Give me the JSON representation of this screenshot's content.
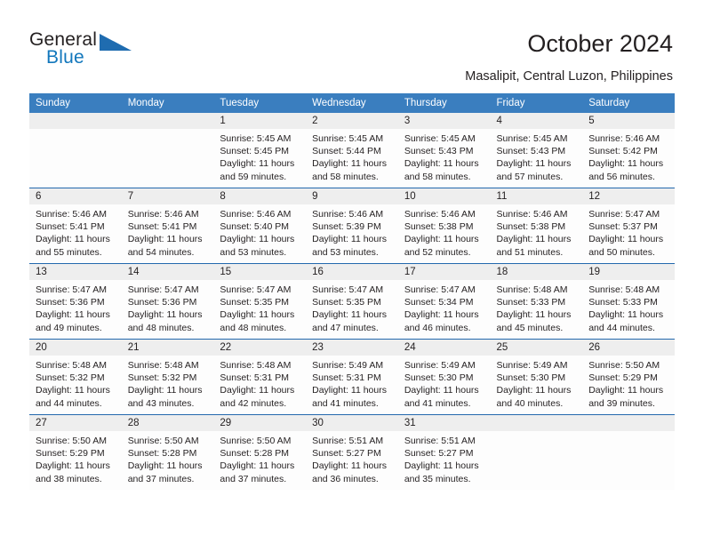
{
  "logo": {
    "line1": "General",
    "line2": "Blue",
    "triangle_icon": "blue-triangle-icon",
    "accent_color": "#1277bc"
  },
  "header": {
    "title": "October 2024",
    "subtitle": "Masalipit, Central Luzon, Philippines"
  },
  "calendar": {
    "header_bg": "#3a7ebf",
    "row_border_color": "#2368ad",
    "daynum_bg": "#eeeeee",
    "weekdays": [
      "Sunday",
      "Monday",
      "Tuesday",
      "Wednesday",
      "Thursday",
      "Friday",
      "Saturday"
    ],
    "weeks": [
      [
        {
          "day": "",
          "empty": true
        },
        {
          "day": "",
          "empty": true
        },
        {
          "day": "1",
          "sunrise": "Sunrise: 5:45 AM",
          "sunset": "Sunset: 5:45 PM",
          "daylight1": "Daylight: 11 hours",
          "daylight2": "and 59 minutes."
        },
        {
          "day": "2",
          "sunrise": "Sunrise: 5:45 AM",
          "sunset": "Sunset: 5:44 PM",
          "daylight1": "Daylight: 11 hours",
          "daylight2": "and 58 minutes."
        },
        {
          "day": "3",
          "sunrise": "Sunrise: 5:45 AM",
          "sunset": "Sunset: 5:43 PM",
          "daylight1": "Daylight: 11 hours",
          "daylight2": "and 58 minutes."
        },
        {
          "day": "4",
          "sunrise": "Sunrise: 5:45 AM",
          "sunset": "Sunset: 5:43 PM",
          "daylight1": "Daylight: 11 hours",
          "daylight2": "and 57 minutes."
        },
        {
          "day": "5",
          "sunrise": "Sunrise: 5:46 AM",
          "sunset": "Sunset: 5:42 PM",
          "daylight1": "Daylight: 11 hours",
          "daylight2": "and 56 minutes."
        }
      ],
      [
        {
          "day": "6",
          "sunrise": "Sunrise: 5:46 AM",
          "sunset": "Sunset: 5:41 PM",
          "daylight1": "Daylight: 11 hours",
          "daylight2": "and 55 minutes."
        },
        {
          "day": "7",
          "sunrise": "Sunrise: 5:46 AM",
          "sunset": "Sunset: 5:41 PM",
          "daylight1": "Daylight: 11 hours",
          "daylight2": "and 54 minutes."
        },
        {
          "day": "8",
          "sunrise": "Sunrise: 5:46 AM",
          "sunset": "Sunset: 5:40 PM",
          "daylight1": "Daylight: 11 hours",
          "daylight2": "and 53 minutes."
        },
        {
          "day": "9",
          "sunrise": "Sunrise: 5:46 AM",
          "sunset": "Sunset: 5:39 PM",
          "daylight1": "Daylight: 11 hours",
          "daylight2": "and 53 minutes."
        },
        {
          "day": "10",
          "sunrise": "Sunrise: 5:46 AM",
          "sunset": "Sunset: 5:38 PM",
          "daylight1": "Daylight: 11 hours",
          "daylight2": "and 52 minutes."
        },
        {
          "day": "11",
          "sunrise": "Sunrise: 5:46 AM",
          "sunset": "Sunset: 5:38 PM",
          "daylight1": "Daylight: 11 hours",
          "daylight2": "and 51 minutes."
        },
        {
          "day": "12",
          "sunrise": "Sunrise: 5:47 AM",
          "sunset": "Sunset: 5:37 PM",
          "daylight1": "Daylight: 11 hours",
          "daylight2": "and 50 minutes."
        }
      ],
      [
        {
          "day": "13",
          "sunrise": "Sunrise: 5:47 AM",
          "sunset": "Sunset: 5:36 PM",
          "daylight1": "Daylight: 11 hours",
          "daylight2": "and 49 minutes."
        },
        {
          "day": "14",
          "sunrise": "Sunrise: 5:47 AM",
          "sunset": "Sunset: 5:36 PM",
          "daylight1": "Daylight: 11 hours",
          "daylight2": "and 48 minutes."
        },
        {
          "day": "15",
          "sunrise": "Sunrise: 5:47 AM",
          "sunset": "Sunset: 5:35 PM",
          "daylight1": "Daylight: 11 hours",
          "daylight2": "and 48 minutes."
        },
        {
          "day": "16",
          "sunrise": "Sunrise: 5:47 AM",
          "sunset": "Sunset: 5:35 PM",
          "daylight1": "Daylight: 11 hours",
          "daylight2": "and 47 minutes."
        },
        {
          "day": "17",
          "sunrise": "Sunrise: 5:47 AM",
          "sunset": "Sunset: 5:34 PM",
          "daylight1": "Daylight: 11 hours",
          "daylight2": "and 46 minutes."
        },
        {
          "day": "18",
          "sunrise": "Sunrise: 5:48 AM",
          "sunset": "Sunset: 5:33 PM",
          "daylight1": "Daylight: 11 hours",
          "daylight2": "and 45 minutes."
        },
        {
          "day": "19",
          "sunrise": "Sunrise: 5:48 AM",
          "sunset": "Sunset: 5:33 PM",
          "daylight1": "Daylight: 11 hours",
          "daylight2": "and 44 minutes."
        }
      ],
      [
        {
          "day": "20",
          "sunrise": "Sunrise: 5:48 AM",
          "sunset": "Sunset: 5:32 PM",
          "daylight1": "Daylight: 11 hours",
          "daylight2": "and 44 minutes."
        },
        {
          "day": "21",
          "sunrise": "Sunrise: 5:48 AM",
          "sunset": "Sunset: 5:32 PM",
          "daylight1": "Daylight: 11 hours",
          "daylight2": "and 43 minutes."
        },
        {
          "day": "22",
          "sunrise": "Sunrise: 5:48 AM",
          "sunset": "Sunset: 5:31 PM",
          "daylight1": "Daylight: 11 hours",
          "daylight2": "and 42 minutes."
        },
        {
          "day": "23",
          "sunrise": "Sunrise: 5:49 AM",
          "sunset": "Sunset: 5:31 PM",
          "daylight1": "Daylight: 11 hours",
          "daylight2": "and 41 minutes."
        },
        {
          "day": "24",
          "sunrise": "Sunrise: 5:49 AM",
          "sunset": "Sunset: 5:30 PM",
          "daylight1": "Daylight: 11 hours",
          "daylight2": "and 41 minutes."
        },
        {
          "day": "25",
          "sunrise": "Sunrise: 5:49 AM",
          "sunset": "Sunset: 5:30 PM",
          "daylight1": "Daylight: 11 hours",
          "daylight2": "and 40 minutes."
        },
        {
          "day": "26",
          "sunrise": "Sunrise: 5:50 AM",
          "sunset": "Sunset: 5:29 PM",
          "daylight1": "Daylight: 11 hours",
          "daylight2": "and 39 minutes."
        }
      ],
      [
        {
          "day": "27",
          "sunrise": "Sunrise: 5:50 AM",
          "sunset": "Sunset: 5:29 PM",
          "daylight1": "Daylight: 11 hours",
          "daylight2": "and 38 minutes."
        },
        {
          "day": "28",
          "sunrise": "Sunrise: 5:50 AM",
          "sunset": "Sunset: 5:28 PM",
          "daylight1": "Daylight: 11 hours",
          "daylight2": "and 37 minutes."
        },
        {
          "day": "29",
          "sunrise": "Sunrise: 5:50 AM",
          "sunset": "Sunset: 5:28 PM",
          "daylight1": "Daylight: 11 hours",
          "daylight2": "and 37 minutes."
        },
        {
          "day": "30",
          "sunrise": "Sunrise: 5:51 AM",
          "sunset": "Sunset: 5:27 PM",
          "daylight1": "Daylight: 11 hours",
          "daylight2": "and 36 minutes."
        },
        {
          "day": "31",
          "sunrise": "Sunrise: 5:51 AM",
          "sunset": "Sunset: 5:27 PM",
          "daylight1": "Daylight: 11 hours",
          "daylight2": "and 35 minutes."
        },
        {
          "day": "",
          "empty": true
        },
        {
          "day": "",
          "empty": true
        }
      ]
    ]
  }
}
